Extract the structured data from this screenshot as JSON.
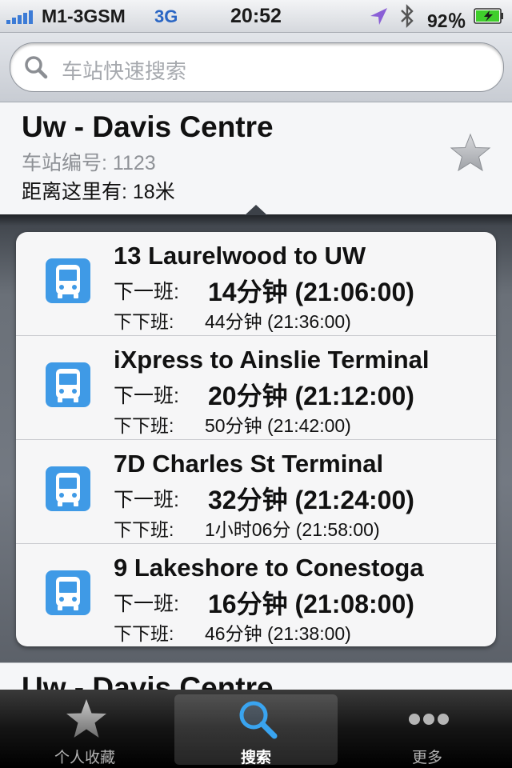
{
  "status": {
    "carrier": "M1-3GSM",
    "network": "3G",
    "time": "20:52",
    "battery": "92％"
  },
  "search": {
    "placeholder": "车站快速搜索"
  },
  "station": {
    "name": "Uw - Davis Centre",
    "code": "车站编号: 1123",
    "distance": "距离这里有: 18米"
  },
  "routes": [
    {
      "name": "13 Laurelwood to UW",
      "next_label": "下一班:",
      "next": "14分钟 (21:06:00)",
      "after_label": "下下班:",
      "after": "44分钟 (21:36:00)"
    },
    {
      "name": "iXpress to Ainslie Terminal",
      "next_label": "下一班:",
      "next": "20分钟 (21:12:00)",
      "after_label": "下下班:",
      "after": "50分钟 (21:42:00)"
    },
    {
      "name": "7D Charles St Terminal",
      "next_label": "下一班:",
      "next": "32分钟 (21:24:00)",
      "after_label": "下下班:",
      "after": "1小时06分 (21:58:00)"
    },
    {
      "name": "9 Lakeshore to Conestoga",
      "next_label": "下一班:",
      "next": "16分钟 (21:08:00)",
      "after_label": "下下班:",
      "after": "46分钟 (21:38:00)"
    }
  ],
  "station2": {
    "name": "Uw - Davis Centre"
  },
  "tabs": [
    {
      "label": "个人收藏",
      "icon": "star-icon"
    },
    {
      "label": "搜索",
      "icon": "search-icon",
      "selected": true
    },
    {
      "label": "更多",
      "icon": "more-icon"
    }
  ],
  "colors": {
    "accent": "#3c7bd6",
    "bus_icon": "#3f9ae6"
  }
}
